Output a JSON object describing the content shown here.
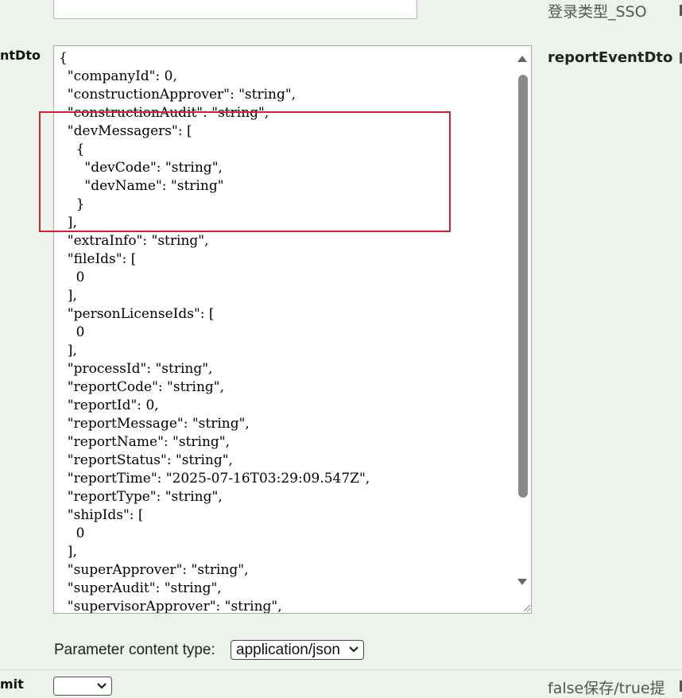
{
  "top_field": {
    "value": ""
  },
  "top_description": "登录类型_SSO",
  "param": {
    "name_fragment": "ntDto",
    "schema_name": "reportEventDto"
  },
  "editor": {
    "lines": [
      "{",
      "  \"companyId\": 0,",
      "  \"constructionApprover\": \"string\",",
      "  \"constructionAudit\": \"string\",",
      "  \"devMessagers\": [",
      "    {",
      "      \"devCode\": \"string\",",
      "      \"devName\": \"string\"",
      "    }",
      "  ],",
      "  \"extraInfo\": \"string\",",
      "  \"fileIds\": [",
      "    0",
      "  ],",
      "  \"personLicenseIds\": [",
      "    0",
      "  ],",
      "  \"processId\": \"string\",",
      "  \"reportCode\": \"string\",",
      "  \"reportId\": 0,",
      "  \"reportMessage\": \"string\",",
      "  \"reportName\": \"string\",",
      "  \"reportStatus\": \"string\",",
      "  \"reportTime\": \"2025-07-16T03:29:09.547Z\",",
      "  \"reportType\": \"string\",",
      "  \"shipIds\": [",
      "    0",
      "  ],",
      "  \"superApprover\": \"string\",",
      "  \"superAudit\": \"string\",",
      "  \"supervisorApprover\": \"string\","
    ]
  },
  "content_type": {
    "label": "Parameter content type:",
    "selected": "application/json"
  },
  "bottom_row": {
    "name_fragment": "mit",
    "select_value": "",
    "description": "false保存/true提"
  },
  "colors": {
    "background": "#ebf3ea",
    "highlight": "#d2232a"
  }
}
